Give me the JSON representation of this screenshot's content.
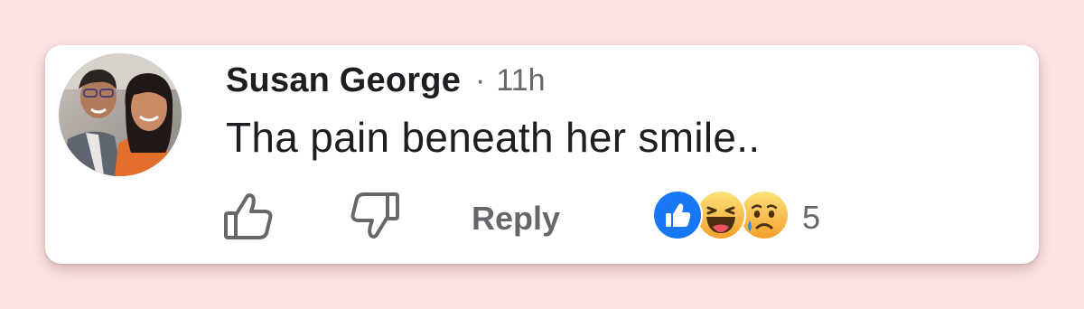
{
  "comment": {
    "author": "Susan George",
    "separator": "·",
    "time_ago": "11h",
    "text": "Tha pain beneath her smile..",
    "avatar_icon": "avatar-photo",
    "actions": {
      "like_icon": "thumbs-up-icon",
      "dislike_icon": "thumbs-down-icon",
      "reply_label": "Reply"
    },
    "reactions": {
      "types": [
        "like",
        "haha",
        "sad"
      ],
      "count": "5"
    }
  },
  "colors": {
    "background": "#fbe3e4",
    "card": "#ffffff",
    "text_primary": "#1c1e21",
    "text_secondary": "#65676b",
    "like_blue": "#1877f2",
    "emoji_yellow": "#f7b928"
  }
}
